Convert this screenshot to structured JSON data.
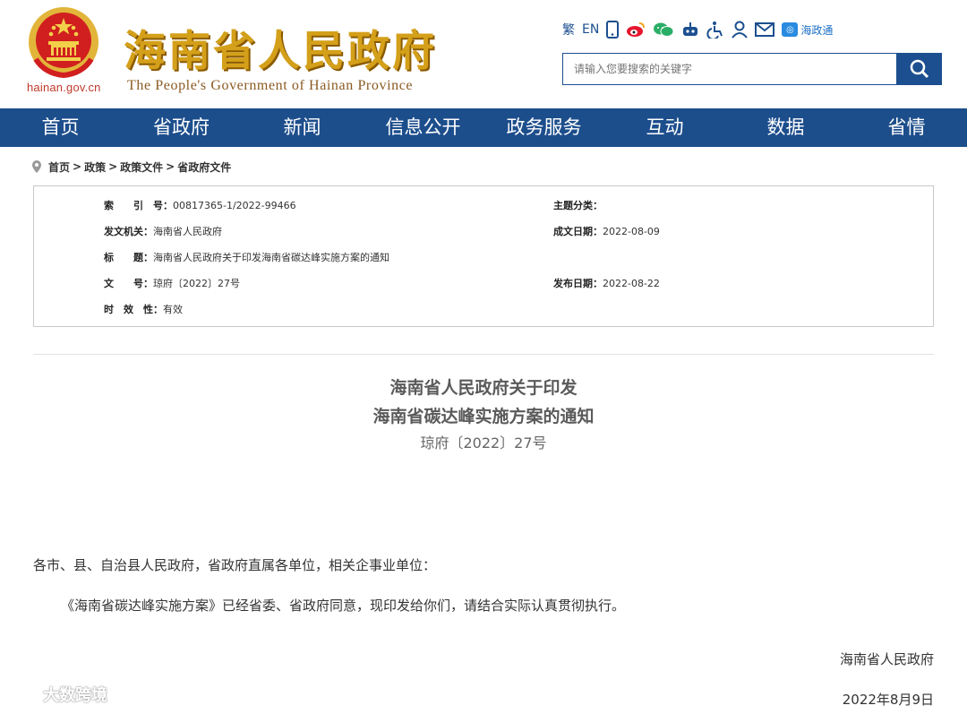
{
  "header": {
    "domain": "hainan.gov.cn",
    "site_name_cn": "海南省人民政府",
    "site_name_en": "The People's Government  of Hainan Province",
    "tools": {
      "traditional": "繁",
      "english": "EN",
      "hzt_label": "海政通"
    },
    "search": {
      "placeholder": "请输入您要搜索的关键字"
    }
  },
  "nav": [
    "首页",
    "省政府",
    "新闻",
    "信息公开",
    "政务服务",
    "互动",
    "数据",
    "省情"
  ],
  "breadcrumb": [
    "首页",
    "政策",
    "政策文件",
    "省政府文件"
  ],
  "info": {
    "index_label": "索　　引　号：",
    "index_value": "00817365-1/2022-99466",
    "topic_label": "主题分类：",
    "topic_value": "",
    "issuer_label": "发文机关：",
    "issuer_value": "海南省人民政府",
    "created_label": "成文日期：",
    "created_value": "2022-08-09",
    "title_label": "标　　题：",
    "title_value": "海南省人民政府关于印发海南省碳达峰实施方案的通知",
    "docno_label": "文　　号：",
    "docno_value": "琼府〔2022〕27号",
    "published_label": "发布日期：",
    "published_value": "2022-08-22",
    "validity_label": "时　效　性：",
    "validity_value": "有效"
  },
  "document": {
    "title_line1": "海南省人民政府关于印发",
    "title_line2": "海南省碳达峰实施方案的通知",
    "doc_number": "琼府〔2022〕27号",
    "salutation": "各市、县、自治县人民政府，省政府直属各单位，相关企事业单位：",
    "paragraph1": "《海南省碳达峰实施方案》已经省委、省政府同意，现印发给你们，请结合实际认真贯彻执行。",
    "signature": "海南省人民政府",
    "date": "2022年8月9日"
  },
  "watermark": "大数跨境",
  "colors": {
    "nav_bg": "#1d4e8c",
    "title_gold": "#d4a01a",
    "emblem_red": "#d11f1f",
    "accent_blue": "#1c4f8f"
  }
}
